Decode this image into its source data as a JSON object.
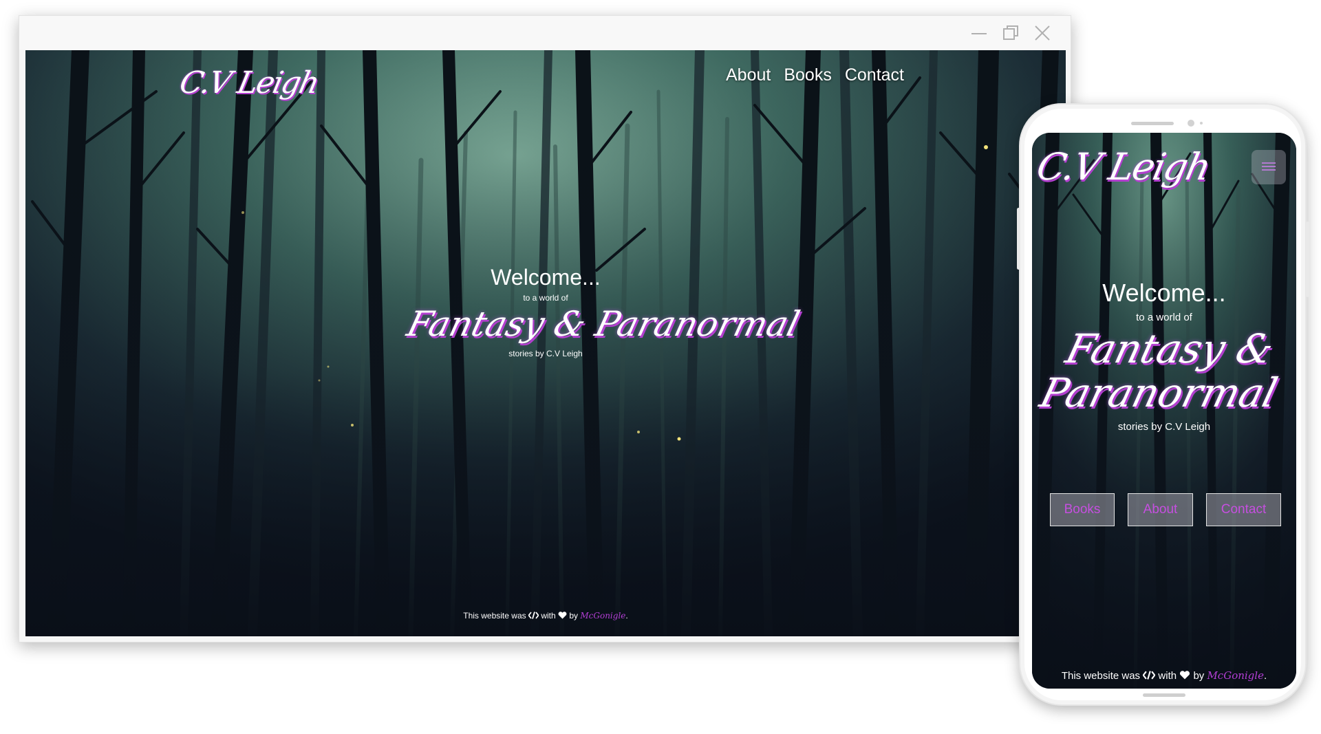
{
  "site": {
    "logo": "C.V Leigh",
    "nav": [
      "About",
      "Books",
      "Contact"
    ],
    "hero": {
      "welcome": "Welcome...",
      "sub": "to a world of",
      "script": "Fantasy & Paranormal",
      "script_line1": "Fantasy &",
      "script_line2": "Paranormal",
      "by": "stories by C.V Leigh"
    },
    "footer": {
      "prefix": "This website was",
      "with": "with",
      "by": "by",
      "credit": "McGonigle",
      "suffix": ".",
      "code_icon": "code-icon",
      "heart_icon": "heart-icon"
    }
  },
  "mobile": {
    "menu_icon": "hamburger-menu-icon",
    "buttons": [
      "Books",
      "About",
      "Contact"
    ]
  },
  "window_controls": [
    "minimize-icon",
    "restore-icon",
    "close-icon"
  ],
  "colors": {
    "accent_purple": "#b33fcf",
    "button_text": "#c64fe0",
    "mist_teal": "#5d8c7e",
    "sky_dark": "#0f1620"
  }
}
